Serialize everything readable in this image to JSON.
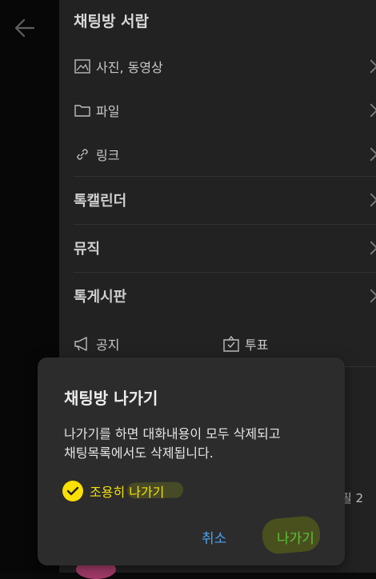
{
  "drawer": {
    "title": "채팅방 서랍",
    "media": {
      "photos_videos": "사진, 동영상",
      "files": "파일",
      "links": "링크"
    },
    "sections": {
      "calendar": "톡캘린더",
      "music": "뮤직",
      "board": "톡게시판"
    },
    "board_items": {
      "notice": "공지",
      "vote": "투표"
    }
  },
  "background": {
    "partial_right_text": "필 2"
  },
  "dialog": {
    "title": "채팅방 나가기",
    "message_line1": "나가기를 하면 대화내용이 모두 삭제되고",
    "message_line2": "채팅목록에서도 삭제됩니다.",
    "quiet_leave_label": "조용히 나가기",
    "quiet_leave_checked": true,
    "cancel_label": "취소",
    "leave_label": "나가기"
  },
  "colors": {
    "accent_yellow": "#f9e000",
    "cancel_blue": "#4aa3f2",
    "leave_green": "#5ac43b"
  },
  "icons": [
    "back-arrow-icon",
    "image-icon",
    "folder-icon",
    "link-icon",
    "chevron-right-icon",
    "megaphone-icon",
    "vote-box-icon",
    "check-icon"
  ]
}
